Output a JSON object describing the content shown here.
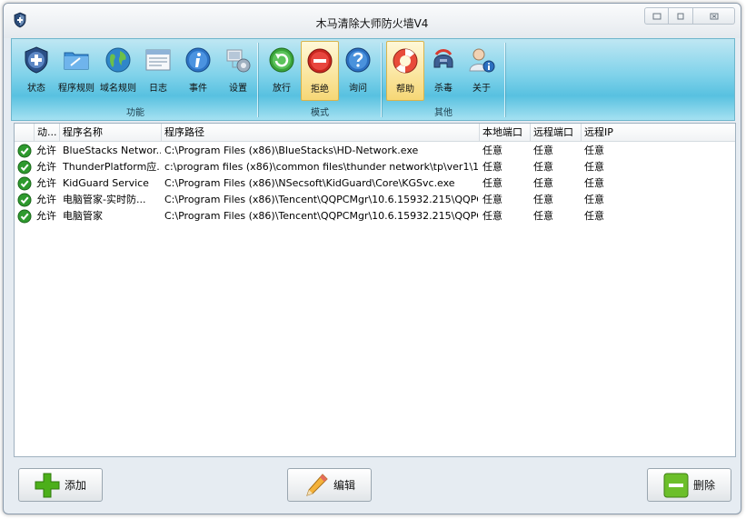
{
  "window": {
    "title": "木马清除大师防火墙V4",
    "controls": {
      "minimize": "▭",
      "maximize": "□",
      "close": "⊠"
    }
  },
  "toolbar": {
    "groups": [
      {
        "label": "功能",
        "tools": [
          {
            "label": "状态",
            "icon": "shield-icon"
          },
          {
            "label": "程序规则",
            "icon": "folder-icon"
          },
          {
            "label": "域名规则",
            "icon": "globe-icon"
          },
          {
            "label": "日志",
            "icon": "log-window-icon"
          },
          {
            "label": "事件",
            "icon": "info-icon"
          },
          {
            "label": "设置",
            "icon": "network-settings-icon"
          }
        ]
      },
      {
        "label": "模式",
        "tools": [
          {
            "label": "放行",
            "icon": "green-arrow-icon"
          },
          {
            "label": "拒绝",
            "icon": "red-stop-icon",
            "active": true
          },
          {
            "label": "询问",
            "icon": "question-icon"
          }
        ]
      },
      {
        "label": "其他",
        "tools": [
          {
            "label": "帮助",
            "icon": "lifebuoy-icon",
            "active": true
          },
          {
            "label": "杀毒",
            "icon": "helmet-icon"
          },
          {
            "label": "关于",
            "icon": "user-info-icon"
          }
        ]
      }
    ]
  },
  "table": {
    "columns": [
      "动...",
      "程序名称",
      "程序路径",
      "本地端口",
      "远程端口",
      "远程IP"
    ],
    "rows": [
      {
        "action": "允许",
        "name": "BlueStacks Networ...",
        "path": "C:\\Program Files (x86)\\BlueStacks\\HD-Network.exe",
        "local_port": "任意",
        "remote_port": "任意",
        "remote_ip": "任意"
      },
      {
        "action": "允许",
        "name": "ThunderPlatform应...",
        "path": "c:\\program files (x86)\\common files\\thunder network\\tp\\ver1\\1.1....",
        "local_port": "任意",
        "remote_port": "任意",
        "remote_ip": "任意"
      },
      {
        "action": "允许",
        "name": "KidGuard Service",
        "path": "C:\\Program Files (x86)\\NSecsoft\\KidGuard\\Core\\KGSvc.exe",
        "local_port": "任意",
        "remote_port": "任意",
        "remote_ip": "任意"
      },
      {
        "action": "允许",
        "name": "电脑管家-实时防...",
        "path": "C:\\Program Files (x86)\\Tencent\\QQPCMgr\\10.6.15932.215\\QQPCRt...",
        "local_port": "任意",
        "remote_port": "任意",
        "remote_ip": "任意"
      },
      {
        "action": "允许",
        "name": "电脑管家",
        "path": "C:\\Program Files (x86)\\Tencent\\QQPCMgr\\10.6.15932.215\\QQPCTr...",
        "local_port": "任意",
        "remote_port": "任意",
        "remote_ip": "任意"
      }
    ]
  },
  "buttons": {
    "add": "添加",
    "edit": "编辑",
    "delete": "删除"
  },
  "colors": {
    "ribbon": "#58c1e0",
    "allow_green": "#2e9a2e",
    "add_green": "#4caf1a"
  }
}
